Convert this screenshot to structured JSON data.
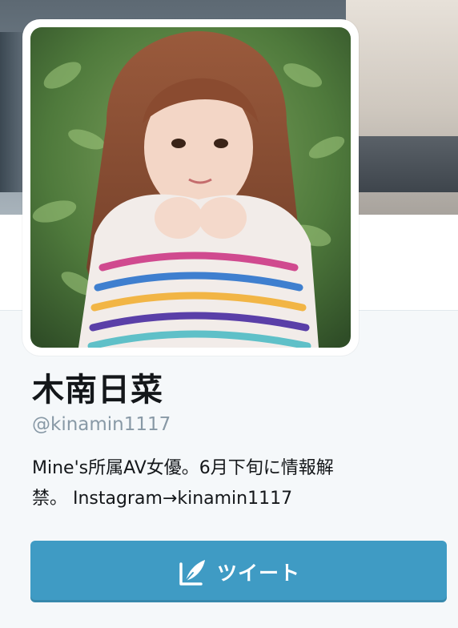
{
  "profile": {
    "display_name": "木南日菜",
    "handle": "@kinamin1117",
    "bio_line1": "Mine's所属AV女優。6月下旬に情報解",
    "bio_line2": "禁。 Instagram→kinamin1117"
  },
  "actions": {
    "tweet_label": "ツイート",
    "tweet_icon": "quill-pen-icon"
  },
  "colors": {
    "page_background": "#f5f8fa",
    "button_background": "#3f9bc4",
    "name_text": "#14171a",
    "handle_text": "#8899a6"
  }
}
